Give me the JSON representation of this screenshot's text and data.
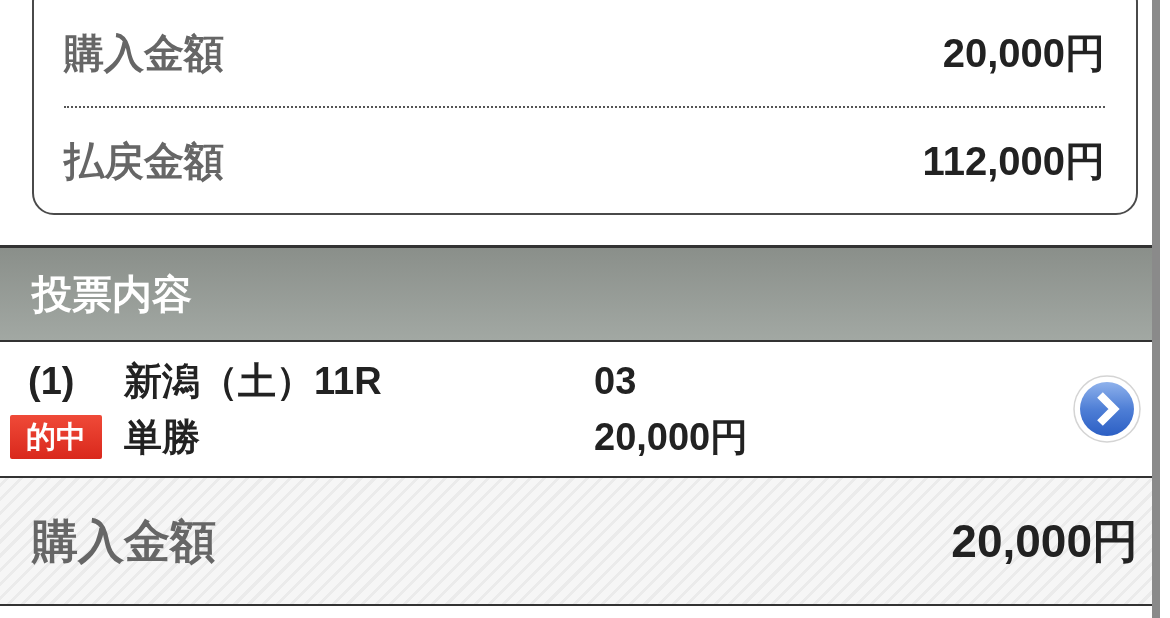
{
  "summary": {
    "rows": [
      {
        "label": "購入金額",
        "value": "20,000円"
      },
      {
        "label": "払戻金額",
        "value": "112,000円"
      }
    ]
  },
  "bets_section": {
    "title": "投票内容",
    "bets": [
      {
        "number": "(1)",
        "race": "新潟（土）11R",
        "selection": "03",
        "hit": true,
        "hit_label": "的中",
        "bet_type": "単勝",
        "amount": "20,000円"
      }
    ]
  },
  "total": {
    "label": "購入金額",
    "value": "20,000円"
  }
}
